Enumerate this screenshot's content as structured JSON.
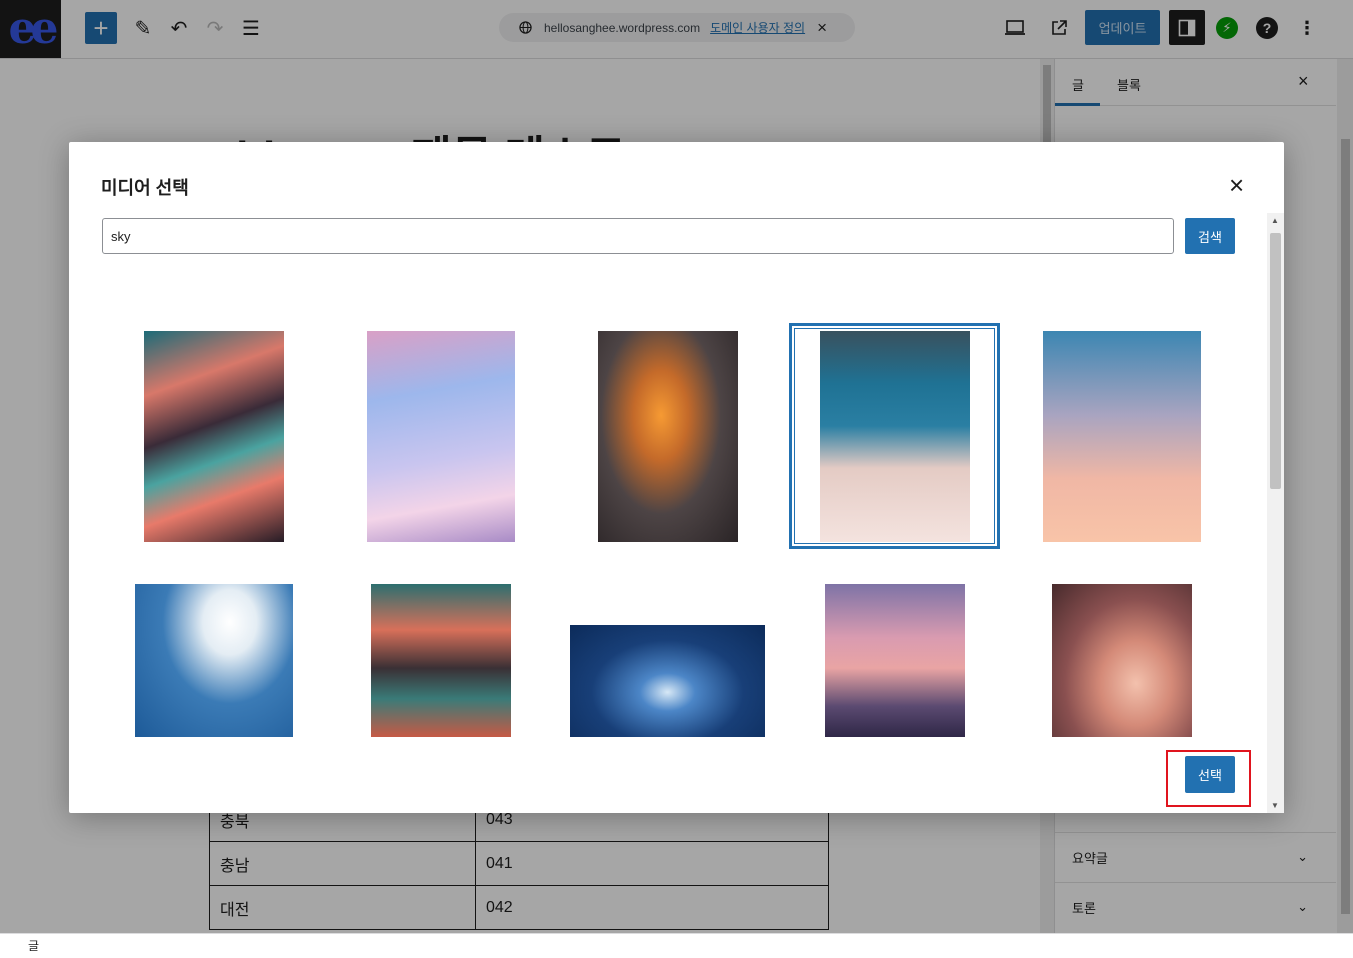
{
  "topbar": {
    "logo": "ee",
    "add_icon": "+",
    "tools_icon": "✎",
    "undo_icon": "↶",
    "redo_icon": "↷",
    "list_view_icon": "☰",
    "site_url": "hellosanghee.wordpress.com",
    "domain_link": "도메인 사용자 정의",
    "dismiss_icon": "×",
    "update_label": "업데이트",
    "jetpack_icon": "⚡",
    "help_icon": "?",
    "more_icon": "⋮"
  },
  "canvas": {
    "post_title": "Title Test 제목 테스트",
    "table_rows": [
      {
        "region": "충북",
        "code": "043"
      },
      {
        "region": "충남",
        "code": "041"
      },
      {
        "region": "대전",
        "code": "042"
      }
    ]
  },
  "sidebar": {
    "tab_post": "글",
    "tab_block": "블록",
    "close_icon": "×",
    "panels": [
      {
        "label": "요약글"
      },
      {
        "label": "토론"
      }
    ]
  },
  "modal": {
    "title": "미디어 선택",
    "close_icon": "×",
    "search_value": "sky",
    "search_button": "검색",
    "select_button": "선택",
    "selected_index": 3
  },
  "statusbar": {
    "label": "글"
  }
}
